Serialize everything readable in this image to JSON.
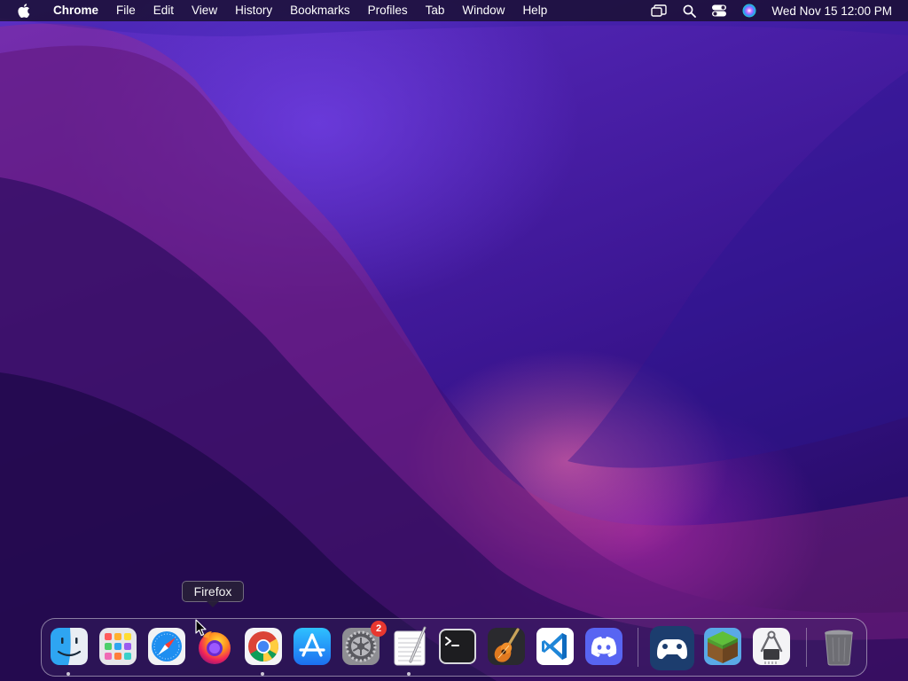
{
  "menubar": {
    "app_name": "Chrome",
    "items": [
      "File",
      "Edit",
      "View",
      "History",
      "Bookmarks",
      "Profiles",
      "Tab",
      "Window",
      "Help"
    ],
    "datetime": "Wed Nov 15  12:00 PM",
    "status_icons": [
      "screen-mirroring-icon",
      "spotlight-search-icon",
      "control-center-icon",
      "siri-icon"
    ]
  },
  "tooltip": {
    "text": "Firefox"
  },
  "dock": {
    "apps": [
      {
        "name": "Finder",
        "icon": "finder-icon",
        "running": true
      },
      {
        "name": "Launchpad",
        "icon": "launchpad-icon",
        "running": false
      },
      {
        "name": "Safari",
        "icon": "safari-icon",
        "running": false
      },
      {
        "name": "Firefox",
        "icon": "firefox-icon",
        "running": false
      },
      {
        "name": "Google Chrome",
        "icon": "chrome-icon",
        "running": true
      },
      {
        "name": "App Store",
        "icon": "app-store-icon",
        "running": false
      },
      {
        "name": "System Preferences",
        "icon": "system-preferences-icon",
        "running": false,
        "badge": "2"
      },
      {
        "name": "TextEdit",
        "icon": "textedit-icon",
        "running": true
      },
      {
        "name": "Terminal",
        "icon": "terminal-icon",
        "running": false
      },
      {
        "name": "GarageBand",
        "icon": "garageband-icon",
        "running": false
      },
      {
        "name": "Visual Studio Code",
        "icon": "vscode-icon",
        "running": false
      },
      {
        "name": "Discord",
        "icon": "discord-icon",
        "running": false
      },
      {
        "name": "Steam Link",
        "icon": "steam-link-icon",
        "running": false
      },
      {
        "name": "Minecraft",
        "icon": "minecraft-icon",
        "running": false
      },
      {
        "name": "System Information",
        "icon": "system-information-icon",
        "running": false
      },
      {
        "name": "Trash",
        "icon": "trash-icon",
        "running": false
      }
    ]
  },
  "colors": {
    "menubar_bg": "#160e28",
    "wallpaper_primary": "#4a1fa8",
    "wallpaper_glow": "#ff78aa",
    "badge": "#e8372f"
  }
}
